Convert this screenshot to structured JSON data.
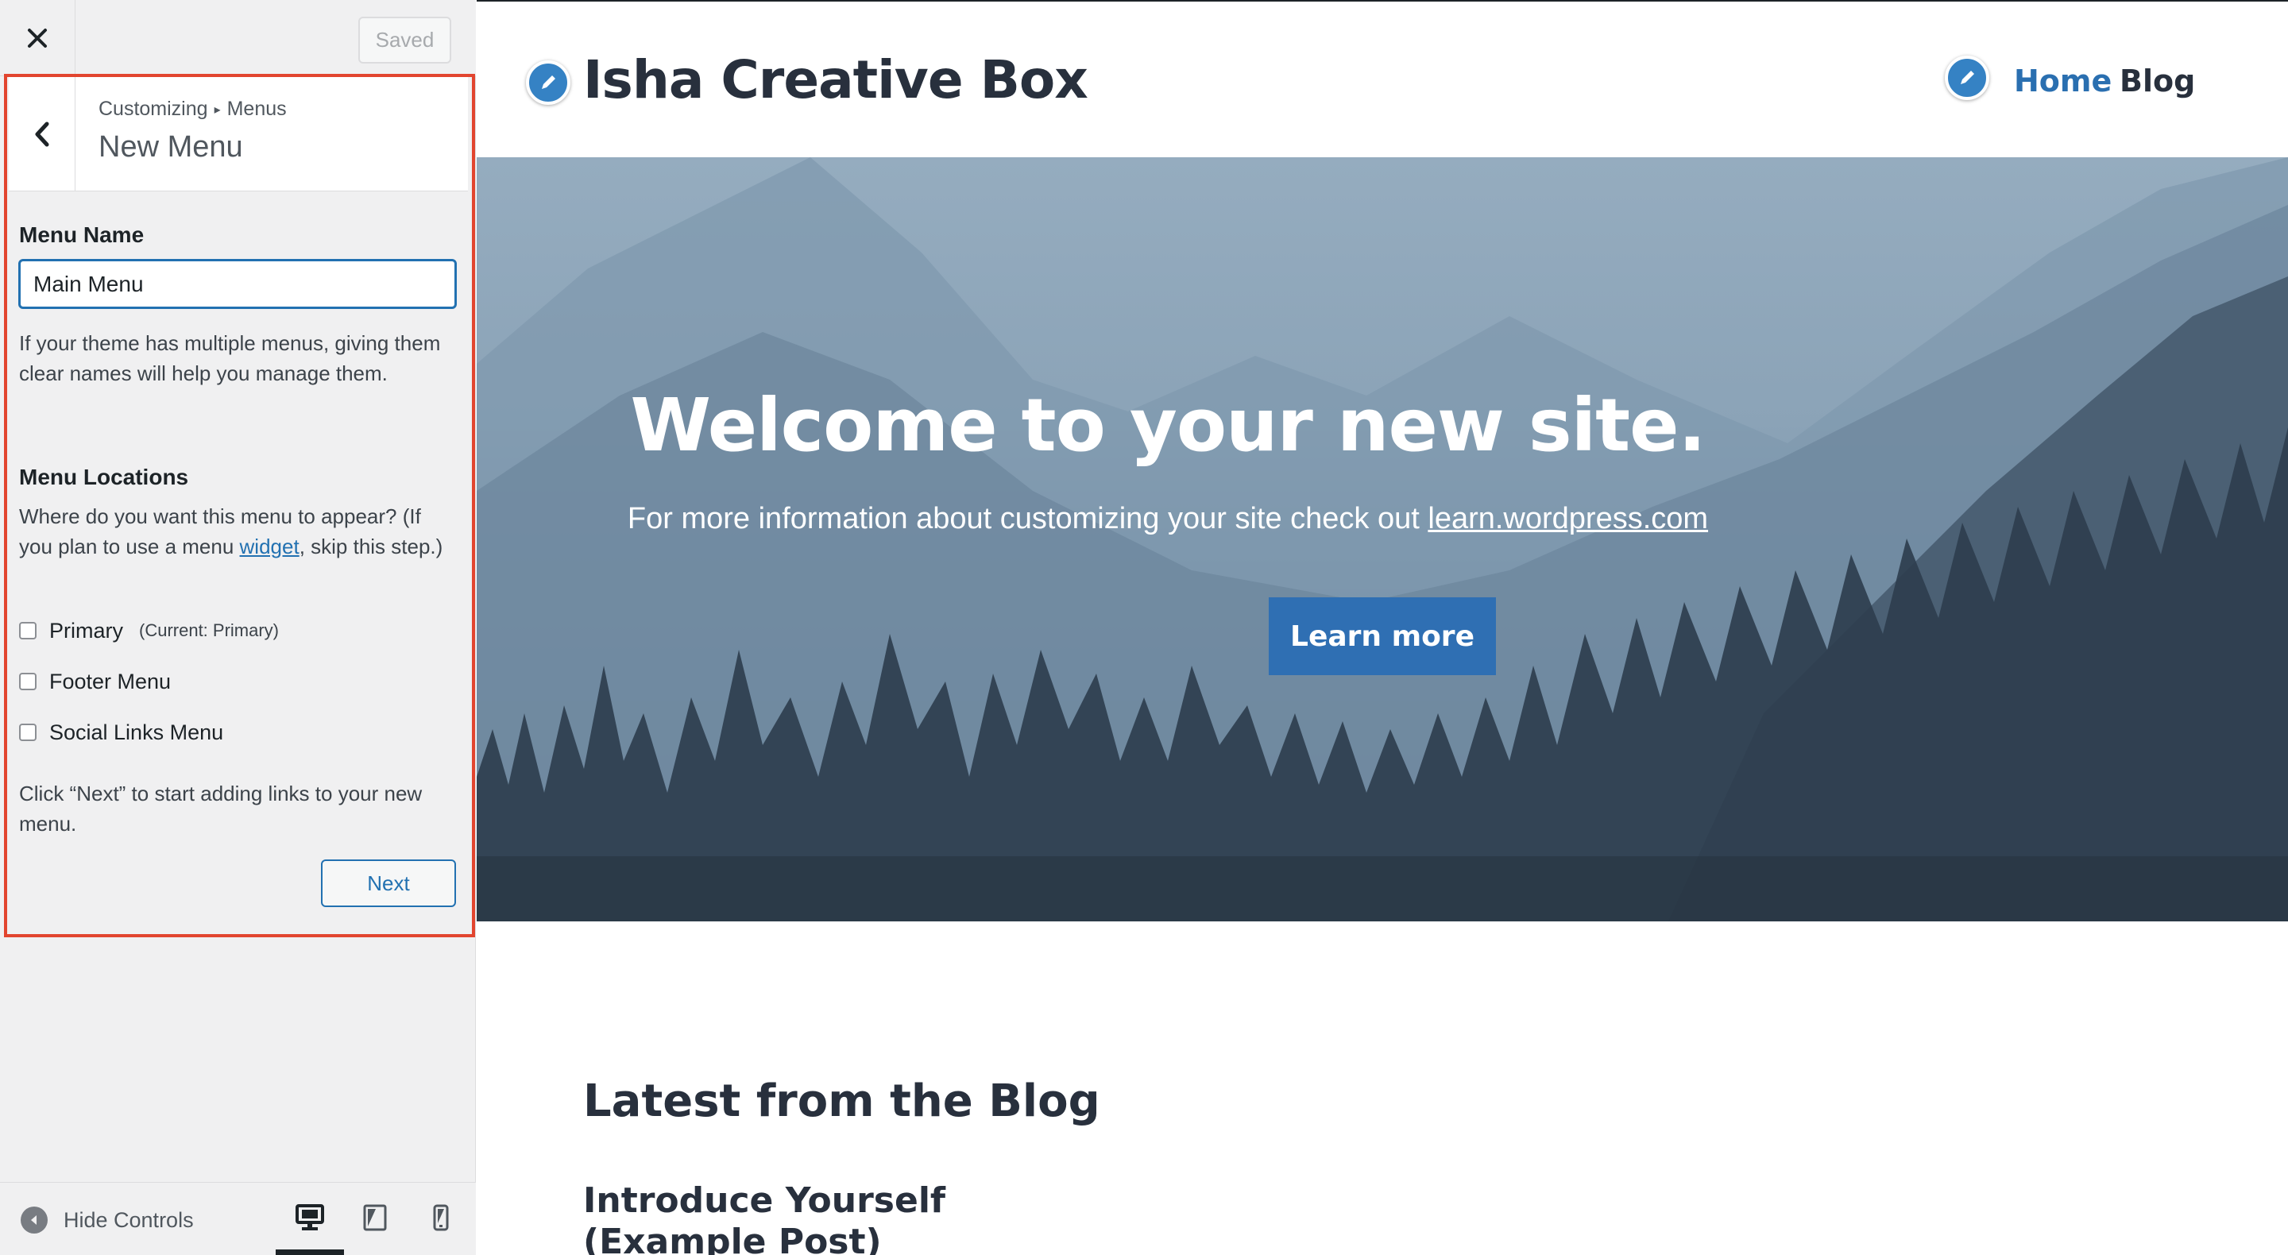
{
  "customizer": {
    "close_icon": "close-icon",
    "saved_label": "Saved",
    "breadcrumb": {
      "parent": "Customizing",
      "child": "Menus"
    },
    "section_title": "New Menu",
    "menu_name_label": "Menu Name",
    "menu_name_value": "Main Menu",
    "menu_name_help": "If your theme has multiple menus, giving them clear names will help you manage them.",
    "locations_label": "Menu Locations",
    "locations_help_before": "Where do you want this menu to appear? (If you plan to use a menu ",
    "locations_help_link": "widget",
    "locations_help_after": ", skip this step.)",
    "locations": [
      {
        "label": "Primary",
        "note": "(Current: Primary)",
        "checked": false
      },
      {
        "label": "Footer Menu",
        "note": "",
        "checked": false
      },
      {
        "label": "Social Links Menu",
        "note": "",
        "checked": false
      }
    ],
    "next_hint": "Click “Next” to start adding links to your new menu.",
    "next_label": "Next",
    "hide_controls_label": "Hide Controls",
    "devices": [
      "desktop",
      "tablet",
      "mobile"
    ],
    "active_device": "desktop",
    "accent_color": "#2271b1",
    "highlight_color": "#e2452f"
  },
  "site": {
    "title": "Isha Creative Box",
    "nav": [
      "Home",
      "Blog"
    ],
    "hero_title": "Welcome to your new site.",
    "hero_sub_before": "For more information about customizing your site check out ",
    "hero_sub_link": "learn.wordpress.com",
    "hero_button": "Learn more",
    "blog_heading": "Latest from the Blog",
    "first_post_title": "Introduce Yourself (Example Post)",
    "link_color": "#2a6fb0",
    "button_color": "#2f6fb3"
  }
}
